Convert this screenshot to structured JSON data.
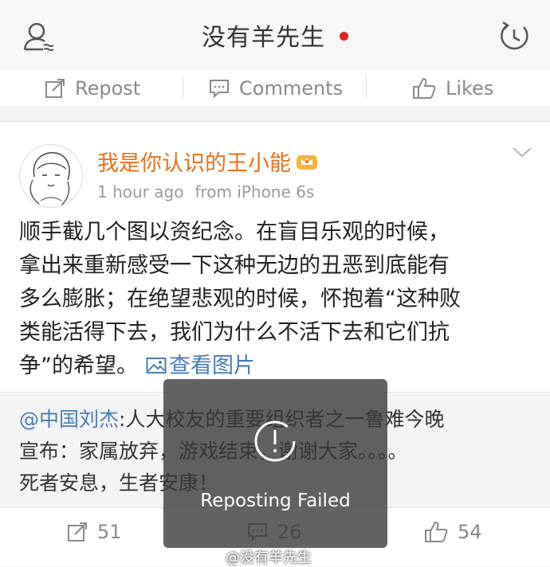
{
  "header": {
    "title": "没有羊先生",
    "dot_color": "#e62020"
  },
  "top_actions": {
    "repost_label": "Repost",
    "comments_label": "Comments",
    "likes_label": "Likes"
  },
  "post": {
    "username": "我是你认识的王小能",
    "time": "1 hour ago",
    "source": "from iPhone 6s",
    "body_lines": [
      "顺手截几个图以资纪念。在盲目乐观的时候，",
      "拿出来重新感受一下这种无边的丑恶到底能有",
      "多么膨胀；在绝望悲观的时候，怀抱着“这种败",
      "类能活得下去，我们为什么不活下去和它们抗",
      "争”的希望。"
    ],
    "view_pic_label": "查看图片",
    "username_color": "#e8701a",
    "link_color": "#4a7bb8"
  },
  "quoted": {
    "mention": "@中国刘杰",
    "line1_rest": ":人大校友的重要组织者之一鲁难今晚",
    "line2": "宣布：家属放弃，游戏结束，谢谢大家。。。。",
    "line3": "死者安息，生者安康！"
  },
  "bottom_actions": {
    "repost_count": "51",
    "comment_count": "26",
    "like_count": "54"
  },
  "toast": {
    "message": "Reposting Failed"
  },
  "watermark": {
    "text": "@没有羊先生"
  },
  "icons": [
    "user-icon",
    "clock-refresh-icon",
    "repost-icon",
    "comment-icon",
    "like-icon",
    "image-icon",
    "chevron-down-icon",
    "crown-badge-icon",
    "spinner-icon"
  ]
}
